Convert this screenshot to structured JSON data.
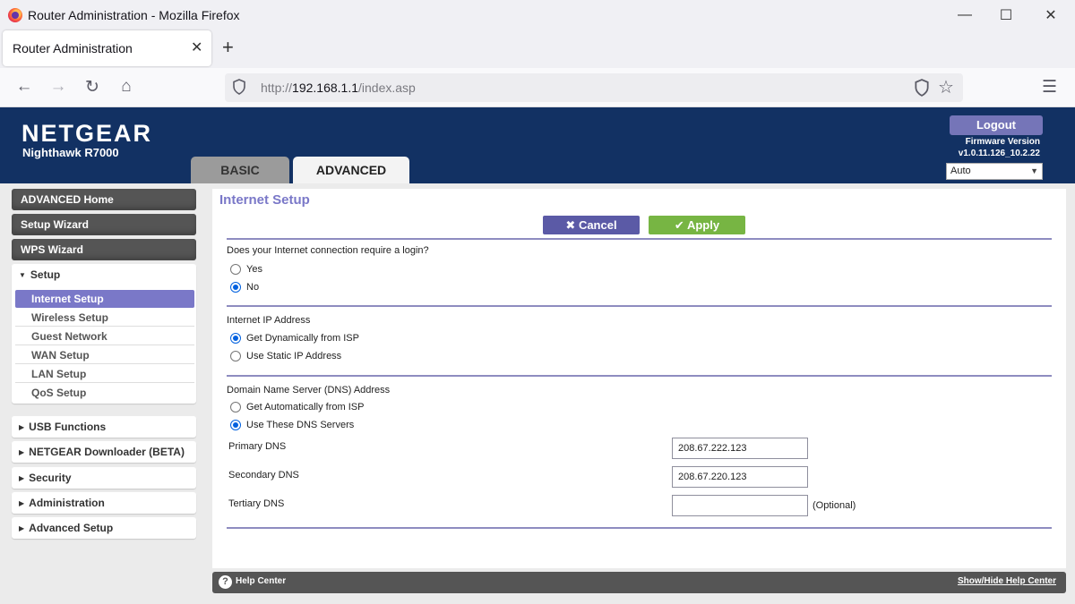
{
  "browser": {
    "window_title": "Router Administration - Mozilla Firefox",
    "tab_title": "Router Administration",
    "url_prefix": "http://",
    "url_host": "192.168.1.1",
    "url_path": "/index.asp"
  },
  "header": {
    "brand": "NETGEAR",
    "model": "Nighthawk R7000",
    "tabs": [
      "BASIC",
      "ADVANCED"
    ],
    "active_tab": "ADVANCED",
    "logout_label": "Logout",
    "firmware_label": "Firmware Version",
    "firmware_version": "v1.0.11.126_10.2.22",
    "language": "Auto"
  },
  "sidebar": {
    "main_items": [
      "ADVANCED Home",
      "Setup Wizard",
      "WPS Wizard"
    ],
    "setup_label": "Setup",
    "setup_items": [
      "Internet Setup",
      "Wireless Setup",
      "Guest Network",
      "WAN Setup",
      "LAN Setup",
      "QoS Setup"
    ],
    "active_item": "Internet Setup",
    "collapsed_sections": [
      "USB Functions",
      "NETGEAR Downloader (BETA)",
      "Security",
      "Administration",
      "Advanced Setup"
    ]
  },
  "content": {
    "title": "Internet Setup",
    "cancel_label": "Cancel",
    "apply_label": "Apply",
    "login_question": "Does your Internet connection require a login?",
    "login_options": [
      "Yes",
      "No"
    ],
    "login_selected": "No",
    "ip_label": "Internet IP Address",
    "ip_options": [
      "Get Dynamically from ISP",
      "Use Static IP Address"
    ],
    "ip_selected": "Get Dynamically from ISP",
    "dns_label": "Domain Name Server (DNS) Address",
    "dns_options": [
      "Get Automatically from ISP",
      "Use These DNS Servers"
    ],
    "dns_selected": "Use These DNS Servers",
    "primary_dns_label": "Primary DNS",
    "primary_dns": "208.67.222.123",
    "secondary_dns_label": "Secondary DNS",
    "secondary_dns": "208.67.220.123",
    "tertiary_dns_label": "Tertiary DNS",
    "tertiary_dns": "",
    "optional_label": "(Optional)"
  },
  "footer": {
    "help_label": "Help Center",
    "toggle_label": "Show/Hide Help Center"
  },
  "colors": {
    "header_bg": "#123163",
    "accent_purple": "#7a78c8",
    "cancel_bg": "#5b5aa6",
    "apply_bg": "#77b543",
    "sidebar_dark": "#555555"
  },
  "icons": [
    "firefox-logo-icon",
    "close-icon",
    "plus-icon",
    "back-icon",
    "forward-icon",
    "reload-icon",
    "home-icon",
    "shield-icon",
    "tracking-shield-icon",
    "star-icon",
    "hamburger-menu-icon",
    "x-icon",
    "check-icon",
    "help-icon",
    "triangle-down-icon",
    "triangle-right-icon"
  ]
}
